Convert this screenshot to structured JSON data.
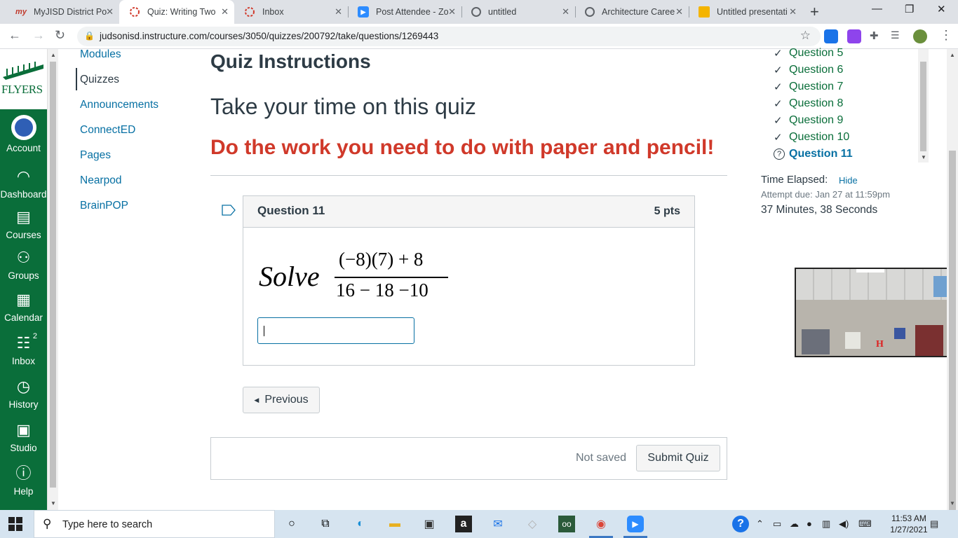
{
  "browser": {
    "tabs": [
      {
        "title": "MyJISD District Po",
        "icon": "myjisd-icon"
      },
      {
        "title": "Quiz: Writing Two",
        "icon": "canvas-icon"
      },
      {
        "title": "Inbox",
        "icon": "canvas-icon"
      },
      {
        "title": "Post Attendee - Zo",
        "icon": "zoom-icon"
      },
      {
        "title": "untitled",
        "icon": "globe-icon"
      },
      {
        "title": "Architecture Caree",
        "icon": "globe-icon"
      },
      {
        "title": "Untitled presentati",
        "icon": "slides-icon"
      }
    ],
    "url": "judsonisd.instructure.com/courses/3050/quizzes/200792/take/questions/1269443"
  },
  "global_nav": {
    "logo_text": "FLYERS",
    "items": [
      {
        "label": "Account",
        "icon": "avatar-icon"
      },
      {
        "label": "Dashboard",
        "icon": "dashboard-icon"
      },
      {
        "label": "Courses",
        "icon": "courses-icon"
      },
      {
        "label": "Groups",
        "icon": "groups-icon"
      },
      {
        "label": "Calendar",
        "icon": "calendar-icon"
      },
      {
        "label": "Inbox",
        "icon": "inbox-icon",
        "badge": "2"
      },
      {
        "label": "History",
        "icon": "history-icon"
      },
      {
        "label": "Studio",
        "icon": "studio-icon"
      },
      {
        "label": "Help",
        "icon": "help-icon"
      }
    ]
  },
  "course_nav": {
    "items": [
      "Modules",
      "Quizzes",
      "Announcements",
      "ConnectED",
      "Pages",
      "Nearpod",
      "BrainPOP"
    ],
    "active": "Quizzes"
  },
  "main": {
    "heading": "Quiz Instructions",
    "line1": "Take your time on this quiz",
    "line2": "Do the work you need to do with paper and pencil!",
    "question": {
      "name": "Question 11",
      "points": "5 pts",
      "word": "Solve",
      "numerator": "(−8)(7) + 8",
      "denominator": "16 − 18 −10",
      "answer_value": ""
    },
    "previous_label": "Previous",
    "save_status": "Not saved",
    "submit_label": "Submit Quiz"
  },
  "sidebar": {
    "questions": [
      {
        "label": "Question 5",
        "state": "answered"
      },
      {
        "label": "Question 6",
        "state": "answered"
      },
      {
        "label": "Question 7",
        "state": "answered"
      },
      {
        "label": "Question 8",
        "state": "answered"
      },
      {
        "label": "Question 9",
        "state": "answered"
      },
      {
        "label": "Question 10",
        "state": "answered"
      },
      {
        "label": "Question 11",
        "state": "current"
      }
    ],
    "time_label": "Time Elapsed:",
    "hide_label": "Hide",
    "attempt_due": "Attempt due: Jan 27 at 11:59pm",
    "elapsed": "37 Minutes, 38 Seconds"
  },
  "taskbar": {
    "search_placeholder": "Type here to search",
    "time": "11:53 AM",
    "date": "1/27/2021"
  },
  "colors": {
    "canvas_green": "#0a6e3a",
    "link_blue": "#0770a3",
    "warning_red": "#d0392a"
  }
}
